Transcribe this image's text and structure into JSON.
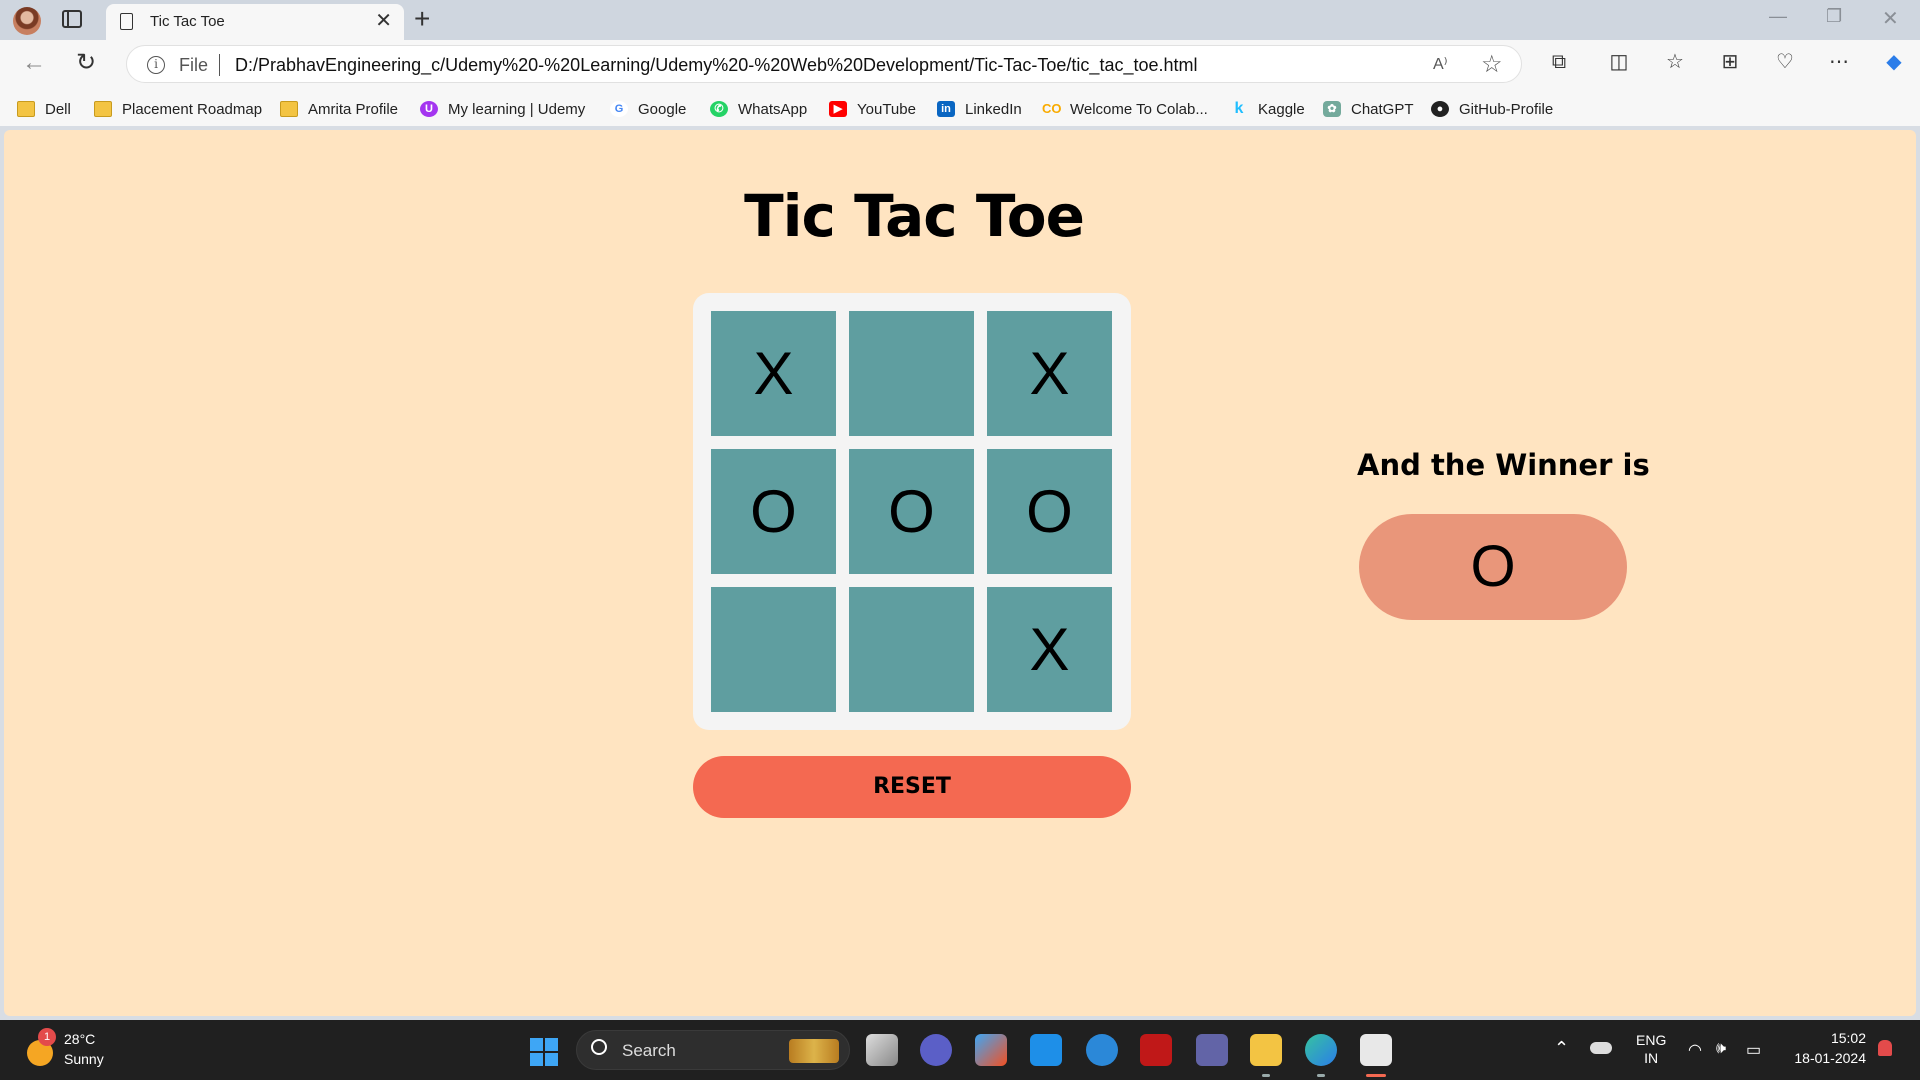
{
  "browser": {
    "tab": {
      "title": "Tic Tac Toe",
      "close": "✕"
    },
    "new_tab": "+",
    "window_controls": {
      "minimize": "—",
      "maximize": "❐",
      "close": "✕"
    },
    "address_bar": {
      "scheme_label": "File",
      "url": "D:/PrabhavEngineering_c/Udemy%20-%20Learning/Udemy%20-%20Web%20Development/Tic-Tac-Toe/tic_tac_toe.html"
    },
    "bookmarks": [
      {
        "label": "Dell",
        "icon": "folder-icon"
      },
      {
        "label": "Placement Roadmap",
        "icon": "folder-icon"
      },
      {
        "label": "Amrita Profile",
        "icon": "folder-icon"
      },
      {
        "label": "My learning | Udemy",
        "icon": "udemy-icon",
        "color": "#a435f0"
      },
      {
        "label": "Google",
        "icon": "google-icon",
        "color": "#4285f4"
      },
      {
        "label": "WhatsApp",
        "icon": "whatsapp-icon",
        "color": "#25d366"
      },
      {
        "label": "YouTube",
        "icon": "youtube-icon",
        "color": "#ff0000"
      },
      {
        "label": "LinkedIn",
        "icon": "linkedin-icon",
        "color": "#0a66c2"
      },
      {
        "label": "Welcome To Colab...",
        "icon": "colab-icon",
        "color": "#f9ab00"
      },
      {
        "label": "Kaggle",
        "icon": "kaggle-icon",
        "color": "#20beff"
      },
      {
        "label": "ChatGPT",
        "icon": "chatgpt-icon",
        "color": "#74aa9c"
      },
      {
        "label": "GitHub-Profile",
        "icon": "github-icon",
        "color": "#222222"
      }
    ]
  },
  "page": {
    "title": "Tic Tac Toe",
    "board": [
      [
        "X",
        "",
        "X"
      ],
      [
        "O",
        "O",
        "O"
      ],
      [
        "",
        "",
        "X"
      ]
    ],
    "reset_label": "RESET",
    "winner_label": "And the Winner is",
    "winner": "O",
    "colors": {
      "background": "#ffe4c1",
      "cell": "#5f9ea0",
      "reset": "#f46951",
      "winner_badge": "#e9967a"
    }
  },
  "taskbar": {
    "weather": {
      "temp": "28°C",
      "desc": "Sunny",
      "badge": "1"
    },
    "search_label": "Search",
    "language": {
      "line1": "ENG",
      "line2": "IN"
    },
    "time": "15:02",
    "date": "18-01-2024"
  }
}
